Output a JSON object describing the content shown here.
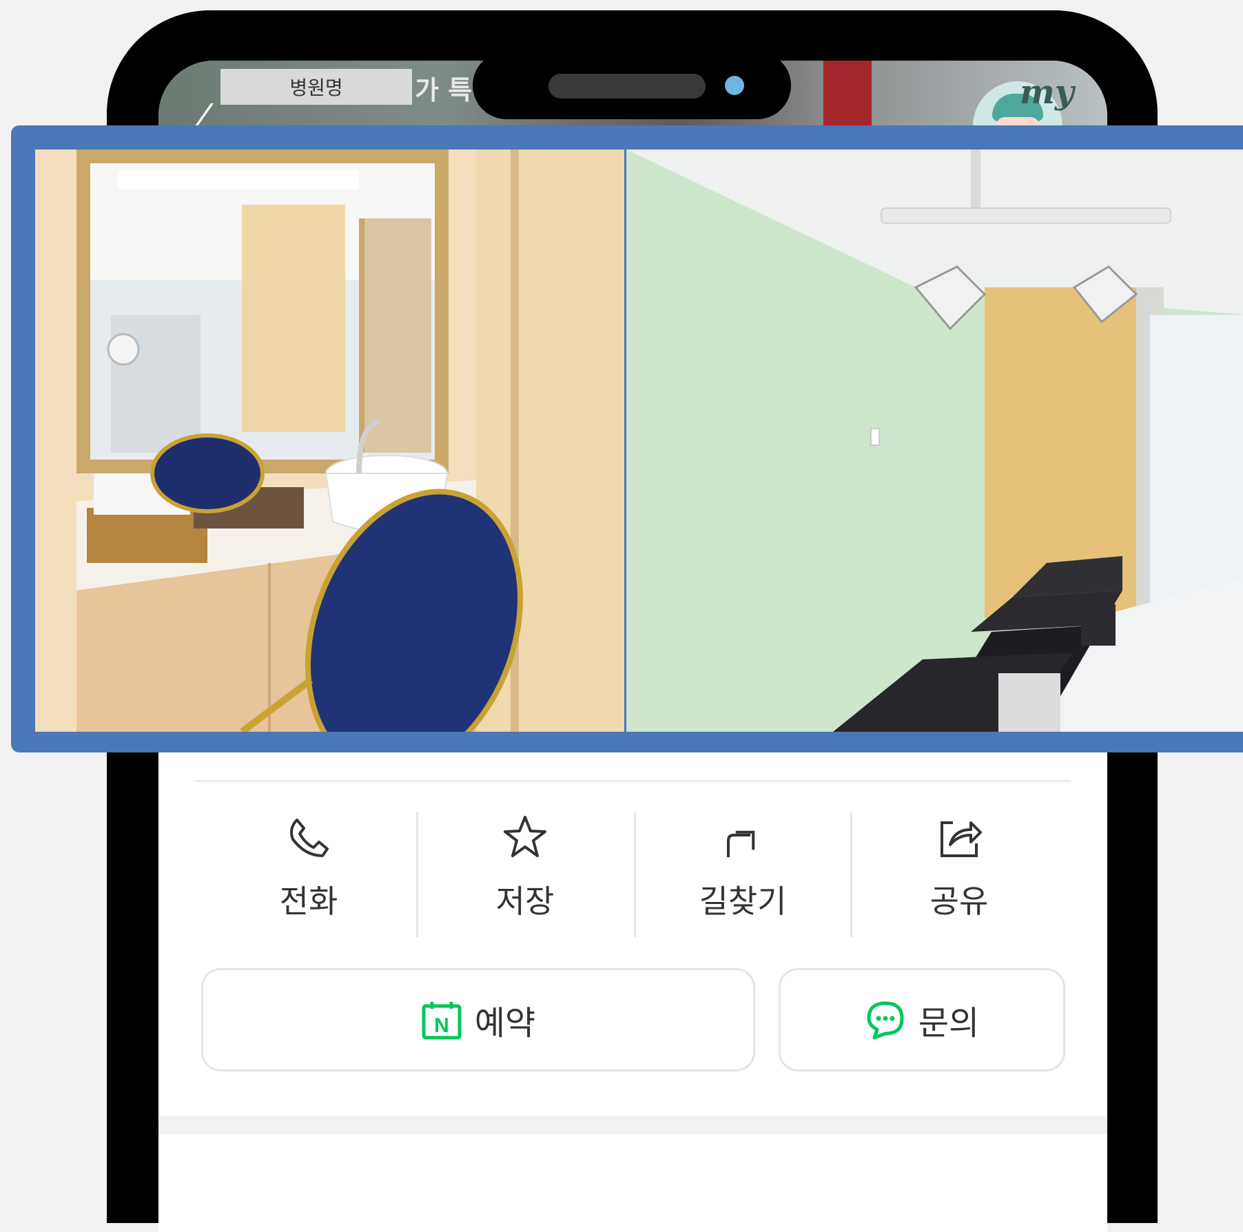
{
  "header": {
    "hospital_name_tag": "병원명",
    "title_partial": "가 특",
    "my_label": "my"
  },
  "gallery": {
    "photos": [
      {
        "description_icon": "powder-room-photo"
      },
      {
        "description_icon": "treatment-room-photo"
      }
    ]
  },
  "actions": {
    "call": "전화",
    "save": "저장",
    "directions": "길찾기",
    "share": "공유"
  },
  "buttons": {
    "reserve": "예약",
    "reserve_badge": "N",
    "inquiry": "문의"
  },
  "colors": {
    "overlay_border": "#4a78b8",
    "naver_green": "#03c75a"
  }
}
